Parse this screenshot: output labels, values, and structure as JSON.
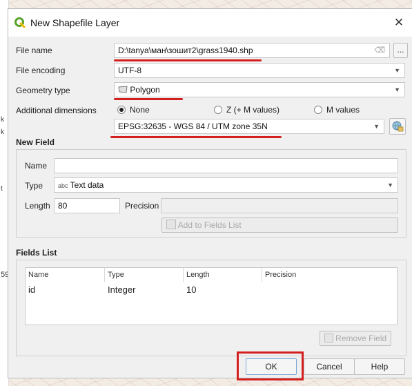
{
  "background": {
    "left_marks": [
      "k",
      "k",
      "t",
      "59"
    ]
  },
  "dialog": {
    "title": "New Shapefile Layer",
    "close_glyph": "✕",
    "file_name": {
      "label": "File name",
      "value": "D:\\tanya\\ман\\зошит2\\grass1940.shp",
      "browse_label": "..."
    },
    "file_encoding": {
      "label": "File encoding",
      "value": "UTF-8"
    },
    "geometry_type": {
      "label": "Geometry type",
      "value": "Polygon"
    },
    "additional_dimensions": {
      "label": "Additional dimensions",
      "options": [
        "None",
        "Z (+ M values)",
        "M values"
      ],
      "selected": "None"
    },
    "crs": {
      "value": "EPSG:32635 - WGS 84 / UTM zone 35N"
    },
    "new_field": {
      "title": "New Field",
      "name_label": "Name",
      "name_value": "",
      "type_label": "Type",
      "type_icon_text": "abc",
      "type_value": "Text data",
      "length_label": "Length",
      "length_value": "80",
      "precision_label": "Precision",
      "precision_value": "",
      "add_button": "Add to Fields List"
    },
    "fields_list": {
      "title": "Fields List",
      "columns": [
        "Name",
        "Type",
        "Length",
        "Precision"
      ],
      "rows": [
        {
          "name": "id",
          "type": "Integer",
          "length": "10",
          "precision": ""
        }
      ],
      "remove_button": "Remove Field"
    },
    "buttons": {
      "ok": "OK",
      "cancel": "Cancel",
      "help": "Help"
    }
  },
  "colors": {
    "annotation_red": "#d41f1f",
    "qgis_green": "#58a32b"
  }
}
